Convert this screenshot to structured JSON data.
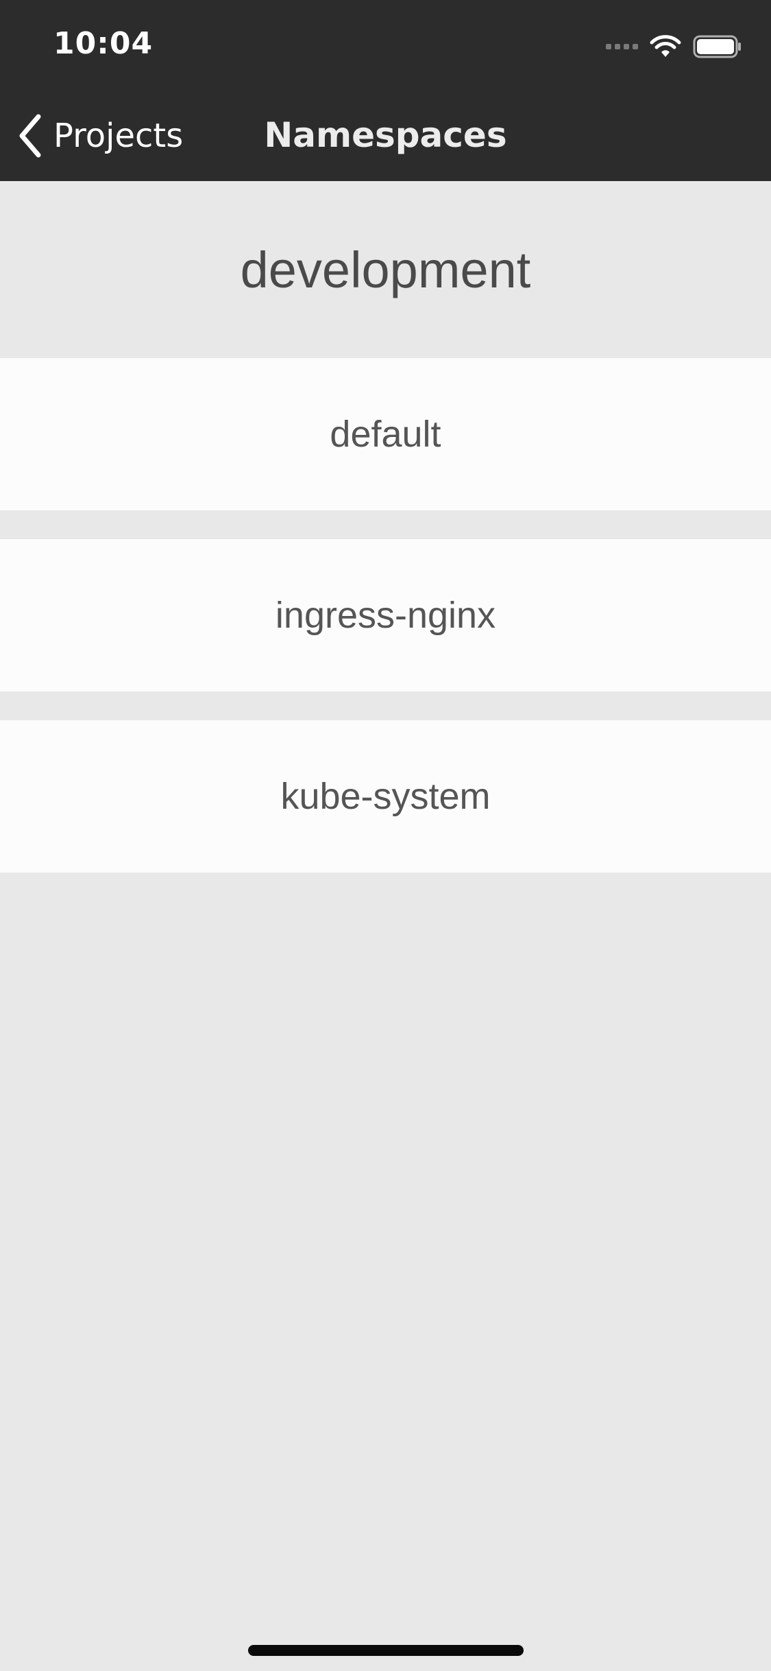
{
  "status_bar": {
    "time": "10:04",
    "icons": [
      "cellular-signal-icon",
      "wifi-icon",
      "battery-icon"
    ]
  },
  "nav": {
    "back_label": "Projects",
    "back_icon": "chevron-left-icon",
    "title": "Namespaces"
  },
  "section": {
    "title": "development"
  },
  "namespaces": [
    {
      "label": "default"
    },
    {
      "label": "ingress-nginx"
    },
    {
      "label": "kube-system"
    }
  ],
  "colors": {
    "header_background": "#2c2c2c",
    "page_background": "#e8e8e8",
    "row_background": "#fcfcfc",
    "text": "#555555"
  }
}
